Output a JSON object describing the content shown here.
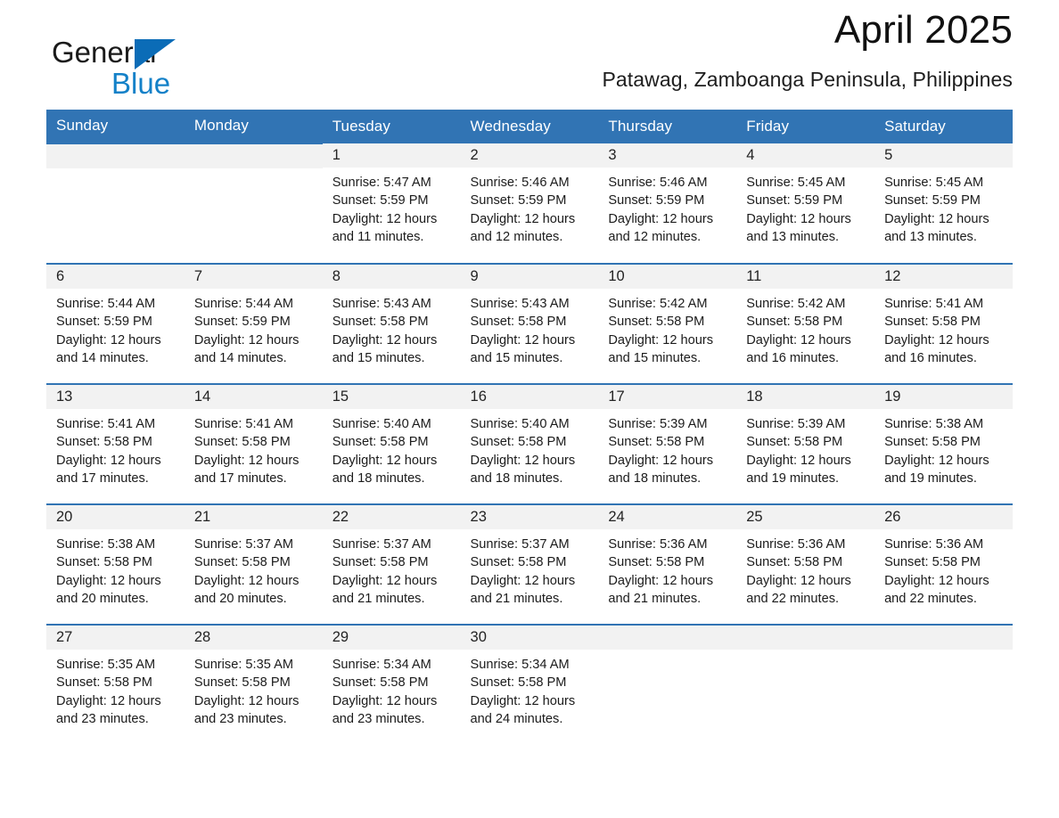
{
  "brand": {
    "name_part1": "General",
    "name_part2": "Blue",
    "accent_color": "#0b6cb7",
    "accent_color_light": "#1481c8"
  },
  "header": {
    "title": "April 2025",
    "subtitle": "Patawag, Zamboanga Peninsula, Philippines"
  },
  "theme": {
    "header_bg": "#3174b4",
    "daynum_bg": "#f2f2f2",
    "text_color": "#1b1b1b"
  },
  "calendar": {
    "weekday_headers": [
      "Sunday",
      "Monday",
      "Tuesday",
      "Wednesday",
      "Thursday",
      "Friday",
      "Saturday"
    ],
    "weeks": [
      [
        {
          "day": "",
          "info": ""
        },
        {
          "day": "",
          "info": ""
        },
        {
          "day": "1",
          "info": "Sunrise: 5:47 AM\nSunset: 5:59 PM\nDaylight: 12 hours\nand 11 minutes."
        },
        {
          "day": "2",
          "info": "Sunrise: 5:46 AM\nSunset: 5:59 PM\nDaylight: 12 hours\nand 12 minutes."
        },
        {
          "day": "3",
          "info": "Sunrise: 5:46 AM\nSunset: 5:59 PM\nDaylight: 12 hours\nand 12 minutes."
        },
        {
          "day": "4",
          "info": "Sunrise: 5:45 AM\nSunset: 5:59 PM\nDaylight: 12 hours\nand 13 minutes."
        },
        {
          "day": "5",
          "info": "Sunrise: 5:45 AM\nSunset: 5:59 PM\nDaylight: 12 hours\nand 13 minutes."
        }
      ],
      [
        {
          "day": "6",
          "info": "Sunrise: 5:44 AM\nSunset: 5:59 PM\nDaylight: 12 hours\nand 14 minutes."
        },
        {
          "day": "7",
          "info": "Sunrise: 5:44 AM\nSunset: 5:59 PM\nDaylight: 12 hours\nand 14 minutes."
        },
        {
          "day": "8",
          "info": "Sunrise: 5:43 AM\nSunset: 5:58 PM\nDaylight: 12 hours\nand 15 minutes."
        },
        {
          "day": "9",
          "info": "Sunrise: 5:43 AM\nSunset: 5:58 PM\nDaylight: 12 hours\nand 15 minutes."
        },
        {
          "day": "10",
          "info": "Sunrise: 5:42 AM\nSunset: 5:58 PM\nDaylight: 12 hours\nand 15 minutes."
        },
        {
          "day": "11",
          "info": "Sunrise: 5:42 AM\nSunset: 5:58 PM\nDaylight: 12 hours\nand 16 minutes."
        },
        {
          "day": "12",
          "info": "Sunrise: 5:41 AM\nSunset: 5:58 PM\nDaylight: 12 hours\nand 16 minutes."
        }
      ],
      [
        {
          "day": "13",
          "info": "Sunrise: 5:41 AM\nSunset: 5:58 PM\nDaylight: 12 hours\nand 17 minutes."
        },
        {
          "day": "14",
          "info": "Sunrise: 5:41 AM\nSunset: 5:58 PM\nDaylight: 12 hours\nand 17 minutes."
        },
        {
          "day": "15",
          "info": "Sunrise: 5:40 AM\nSunset: 5:58 PM\nDaylight: 12 hours\nand 18 minutes."
        },
        {
          "day": "16",
          "info": "Sunrise: 5:40 AM\nSunset: 5:58 PM\nDaylight: 12 hours\nand 18 minutes."
        },
        {
          "day": "17",
          "info": "Sunrise: 5:39 AM\nSunset: 5:58 PM\nDaylight: 12 hours\nand 18 minutes."
        },
        {
          "day": "18",
          "info": "Sunrise: 5:39 AM\nSunset: 5:58 PM\nDaylight: 12 hours\nand 19 minutes."
        },
        {
          "day": "19",
          "info": "Sunrise: 5:38 AM\nSunset: 5:58 PM\nDaylight: 12 hours\nand 19 minutes."
        }
      ],
      [
        {
          "day": "20",
          "info": "Sunrise: 5:38 AM\nSunset: 5:58 PM\nDaylight: 12 hours\nand 20 minutes."
        },
        {
          "day": "21",
          "info": "Sunrise: 5:37 AM\nSunset: 5:58 PM\nDaylight: 12 hours\nand 20 minutes."
        },
        {
          "day": "22",
          "info": "Sunrise: 5:37 AM\nSunset: 5:58 PM\nDaylight: 12 hours\nand 21 minutes."
        },
        {
          "day": "23",
          "info": "Sunrise: 5:37 AM\nSunset: 5:58 PM\nDaylight: 12 hours\nand 21 minutes."
        },
        {
          "day": "24",
          "info": "Sunrise: 5:36 AM\nSunset: 5:58 PM\nDaylight: 12 hours\nand 21 minutes."
        },
        {
          "day": "25",
          "info": "Sunrise: 5:36 AM\nSunset: 5:58 PM\nDaylight: 12 hours\nand 22 minutes."
        },
        {
          "day": "26",
          "info": "Sunrise: 5:36 AM\nSunset: 5:58 PM\nDaylight: 12 hours\nand 22 minutes."
        }
      ],
      [
        {
          "day": "27",
          "info": "Sunrise: 5:35 AM\nSunset: 5:58 PM\nDaylight: 12 hours\nand 23 minutes."
        },
        {
          "day": "28",
          "info": "Sunrise: 5:35 AM\nSunset: 5:58 PM\nDaylight: 12 hours\nand 23 minutes."
        },
        {
          "day": "29",
          "info": "Sunrise: 5:34 AM\nSunset: 5:58 PM\nDaylight: 12 hours\nand 23 minutes."
        },
        {
          "day": "30",
          "info": "Sunrise: 5:34 AM\nSunset: 5:58 PM\nDaylight: 12 hours\nand 24 minutes."
        },
        {
          "day": "",
          "info": ""
        },
        {
          "day": "",
          "info": ""
        },
        {
          "day": "",
          "info": ""
        }
      ]
    ]
  }
}
